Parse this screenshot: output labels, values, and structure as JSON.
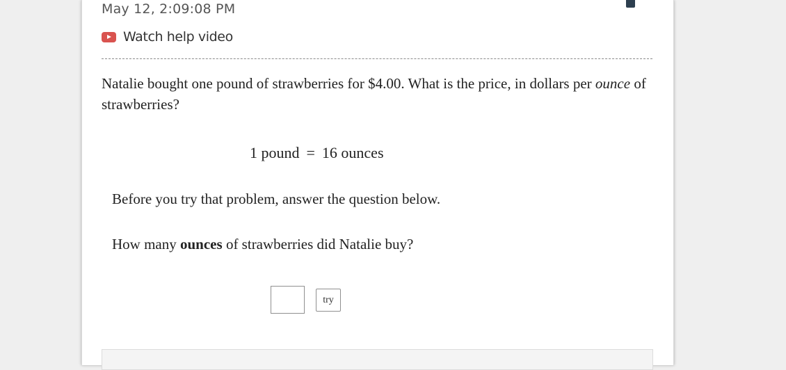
{
  "header": {
    "timestamp": "May 12, 2:09:08 PM",
    "help_video_label": "Watch help video",
    "help_icon": "play-video-icon"
  },
  "problem": {
    "text_before": "Natalie bought one pound of strawberries for $4.00. What is the price, in dollars per ",
    "emphasis": "ounce",
    "text_after": " of strawberries?"
  },
  "equation": {
    "left": "1 pound",
    "sign": "=",
    "right": "16 ounces"
  },
  "prompt": {
    "instruction": "Before you try that problem, answer the question below.",
    "question_before": "How many ",
    "question_bold": "ounces",
    "question_after": " of strawberries did Natalie buy?"
  },
  "answer": {
    "value": "",
    "try_label": "try"
  },
  "colors": {
    "help_icon": "#d9534f",
    "corner_tab": "#2d3f4f",
    "page_background": "#efefef"
  }
}
